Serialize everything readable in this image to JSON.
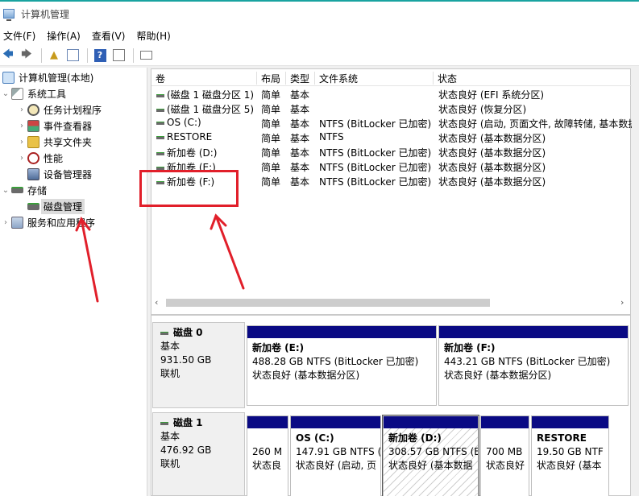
{
  "window": {
    "title": "计算机管理"
  },
  "menu": [
    "文件(F)",
    "操作(A)",
    "查看(V)",
    "帮助(H)"
  ],
  "toolbar": {
    "icons": [
      "back-arrow-icon",
      "forward-arrow-icon",
      "up-folder-icon",
      "show-tree-icon",
      "help-icon",
      "properties-icon",
      "console-icon"
    ],
    "help_glyph": "?"
  },
  "tree": {
    "root": "计算机管理(本地)",
    "items": [
      {
        "label": "系统工具",
        "icon": "tools-icon",
        "expanded": true
      },
      {
        "label": "任务计划程序",
        "icon": "clock-icon"
      },
      {
        "label": "事件查看器",
        "icon": "event-viewer-icon"
      },
      {
        "label": "共享文件夹",
        "icon": "shared-folder-icon"
      },
      {
        "label": "性能",
        "icon": "performance-icon"
      },
      {
        "label": "设备管理器",
        "icon": "device-manager-icon"
      },
      {
        "label": "存储",
        "icon": "storage-icon",
        "expanded": true
      },
      {
        "label": "磁盘管理",
        "icon": "disk-management-icon",
        "selected": true
      },
      {
        "label": "服务和应用程序",
        "icon": "services-icon"
      }
    ]
  },
  "volume_table": {
    "columns": [
      "卷",
      "布局",
      "类型",
      "文件系统",
      "状态"
    ],
    "rows": [
      {
        "volume": "(磁盘 1 磁盘分区 1)",
        "layout": "简单",
        "type": "基本",
        "fs": "",
        "status": "状态良好 (EFI 系统分区)"
      },
      {
        "volume": "(磁盘 1 磁盘分区 5)",
        "layout": "简单",
        "type": "基本",
        "fs": "",
        "status": "状态良好 (恢复分区)"
      },
      {
        "volume": "OS (C:)",
        "layout": "简单",
        "type": "基本",
        "fs": "NTFS (BitLocker 已加密)",
        "status": "状态良好 (启动, 页面文件, 故障转储, 基本数据"
      },
      {
        "volume": "RESTORE",
        "layout": "简单",
        "type": "基本",
        "fs": "NTFS",
        "status": "状态良好 (基本数据分区)"
      },
      {
        "volume": "新加卷 (D:)",
        "layout": "简单",
        "type": "基本",
        "fs": "NTFS (BitLocker 已加密)",
        "status": "状态良好 (基本数据分区)"
      },
      {
        "volume": "新加卷 (E:)",
        "layout": "简单",
        "type": "基本",
        "fs": "NTFS (BitLocker 已加密)",
        "status": "状态良好 (基本数据分区)"
      },
      {
        "volume": "新加卷 (F:)",
        "layout": "简单",
        "type": "基本",
        "fs": "NTFS (BitLocker 已加密)",
        "status": "状态良好 (基本数据分区)"
      }
    ]
  },
  "disks": [
    {
      "name": "磁盘 0",
      "type": "基本",
      "size": "931.50 GB",
      "state": "联机",
      "partitions": [
        {
          "title": "新加卷 (E:)",
          "detail": "488.28 GB NTFS (BitLocker 已加密)",
          "status": "状态良好 (基本数据分区)"
        },
        {
          "title": "新加卷 (F:)",
          "detail": "443.21 GB NTFS (BitLocker 已加密)",
          "status": "状态良好 (基本数据分区)"
        }
      ]
    },
    {
      "name": "磁盘 1",
      "type": "基本",
      "size": "476.92 GB",
      "state": "联机",
      "partitions": [
        {
          "title": "",
          "detail": "260 M",
          "status": "状态良"
        },
        {
          "title": "OS (C:)",
          "detail": "147.91 GB NTFS (",
          "status": "状态良好 (启动, 页"
        },
        {
          "title": "新加卷 (D:)",
          "detail": "308.57 GB NTFS (E",
          "status": "状态良好 (基本数据"
        },
        {
          "title": "",
          "detail": "700 MB",
          "status": "状态良好"
        },
        {
          "title": "RESTORE",
          "detail": "19.50 GB NTF",
          "status": "状态良好 (基本"
        }
      ]
    }
  ],
  "colors": {
    "accent": "#0a0a84",
    "highlight": "#e11f2a",
    "status_ok": "#3a9e3a"
  }
}
